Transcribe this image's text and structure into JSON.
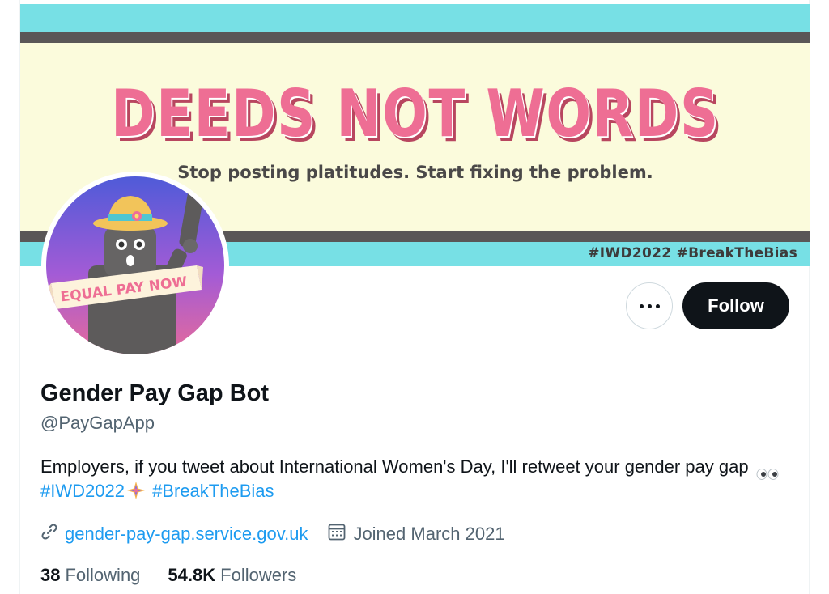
{
  "banner": {
    "headline": "DEEDS NOT WORDS",
    "subline": "Stop posting platitudes. Start fixing the problem.",
    "hashtags": "#IWD2022 #BreakTheBias"
  },
  "avatar": {
    "banner_text": "EQUAL PAY NOW"
  },
  "actions": {
    "more_icon": "ellipsis-icon",
    "follow_label": "Follow"
  },
  "profile": {
    "display_name": "Gender Pay Gap Bot",
    "handle": "@PayGapApp",
    "bio_text": "Employers, if you tweet about International Women's Day, I'll retweet your gender pay gap",
    "bio_emoji": "eyes-emoji",
    "bio_hashtag_1": "#IWD2022",
    "bio_hashtag_emoji": "iwd-sparkle-emoji",
    "bio_hashtag_2": "#BreakTheBias",
    "website_icon": "link-icon",
    "website": "gender-pay-gap.service.gov.uk",
    "joined_icon": "calendar-icon",
    "joined": "Joined March 2021"
  },
  "stats": {
    "following_count": "38",
    "following_label": "Following",
    "followers_count": "54.8K",
    "followers_label": "Followers"
  },
  "colors": {
    "accent": "#1d9bf0",
    "text_primary": "#0f1419",
    "text_secondary": "#536471",
    "banner_pink": "#ee6e94",
    "banner_cyan": "#77e0e5",
    "banner_cream": "#fbfbdc"
  }
}
